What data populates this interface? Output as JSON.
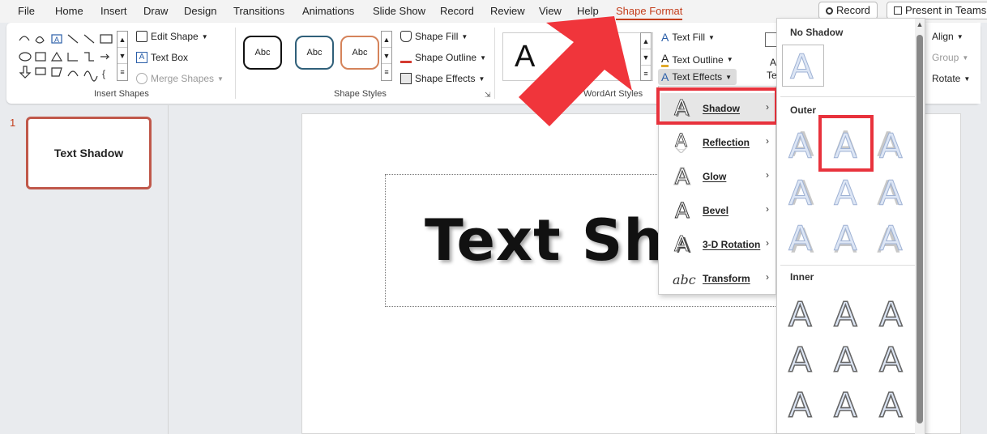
{
  "tabs": [
    "File",
    "Home",
    "Insert",
    "Draw",
    "Design",
    "Transitions",
    "Animations",
    "Slide Show",
    "Record",
    "Review",
    "View",
    "Help",
    "Shape Format"
  ],
  "top_buttons": {
    "record": "Record",
    "present": "Present in Teams"
  },
  "ribbon": {
    "insert_shapes": {
      "edit_shape": "Edit Shape",
      "text_box": "Text Box",
      "merge_shapes": "Merge Shapes",
      "label": "Insert Shapes"
    },
    "shape_styles": {
      "style_sample": "Abc",
      "shape_fill": "Shape Fill",
      "shape_outline": "Shape Outline",
      "shape_effects": "Shape Effects",
      "label": "Shape Styles"
    },
    "wordart": {
      "text_fill": "Text Fill",
      "text_outline": "Text Outline",
      "text_effects": "Text Effects",
      "label": "WordArt Styles",
      "sample_letter": "A"
    },
    "arrange": {
      "align": "Align",
      "group": "Group",
      "rotate": "Rotate",
      "alt_text_partial": "A",
      "alt_text_partial2": "Te"
    }
  },
  "slides": {
    "number": "1",
    "thumb_text": "Text Shadow"
  },
  "slide_text": "Text Shadow",
  "text_effects_menu": [
    {
      "label": "Shadow",
      "icon": "shadow-a-icon"
    },
    {
      "label": "Reflection",
      "icon": "reflection-a-icon"
    },
    {
      "label": "Glow",
      "icon": "glow-a-icon"
    },
    {
      "label": "Bevel",
      "icon": "bevel-a-icon"
    },
    {
      "label": "3-D Rotation",
      "icon": "3d-rotation-a-icon"
    },
    {
      "label": "Transform",
      "icon": "transform-abc-icon"
    }
  ],
  "shadow_gallery": {
    "no_shadow": "No Shadow",
    "outer": "Outer",
    "inner": "Inner",
    "glyph": "A"
  },
  "colors": {
    "accent": "#c43e1c",
    "highlight": "#e8323c",
    "arrow": "#f0353b"
  }
}
